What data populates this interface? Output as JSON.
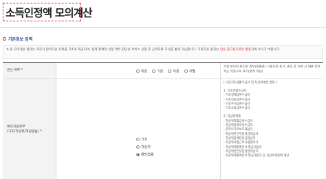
{
  "page": {
    "title": "소득인정액 모의계산"
  },
  "section": {
    "title": "기본정보 입력"
  },
  "notice": {
    "text_main": "※ 본 모의계산 결과는 귀하가 입력하신 자료를 기초로 제공되며, 실제 정확한 선정 여부 판단은 서비스 신청 후 공적자료 조사를 통해 가능합니다. 조회하신 결과는",
    "text_red": "단순 참고용으로만 활용",
    "text_end": "하여 주시기 바랍니다."
  },
  "marital": {
    "label": "혼인 여부 *",
    "options": [
      "미혼",
      "기혼",
      "이혼",
      "사별"
    ],
    "description": "학생 본인이 혼인한 경우(법률혼) 기혼으로 표기, 혼인 후 이혼 시 재혼 전까지는 이혼으로 표기(혼적 아님)"
  },
  "welfare": {
    "label_line1": "복지지원여부",
    "label_line2": "(기초/차상위/해당없음) *",
    "options": [
      "기초",
      "차상위",
      "해당없음"
    ],
    "selected": "해당없음",
    "desc_header": "[ 국민기초생활수급자 및 차상위계층 범위 ]",
    "desc_items": [
      "1. 기초생활수급자",
      "- 기초생계급여수급자",
      "- 기초의료급여수급자",
      "- 기초주거급여수급자",
      "- 기초교육급여수급자",
      "2. 차상위계층",
      "- 차상위자활급여수급자",
      "- 차상위장애수당수급자",
      "- 한부모가족보호대상자",
      "- 차상위본인부담경감대상자",
      "- 차상위장애인연금대상자",
      "- 차상위자활근로사업참여자",
      "- 차상위계층확인서 발급대상자",
      "- 차상위본인부담경감대상자",
      "- 차상위계층확인서 발급대상자 등 차상위계층에 해당"
    ]
  }
}
